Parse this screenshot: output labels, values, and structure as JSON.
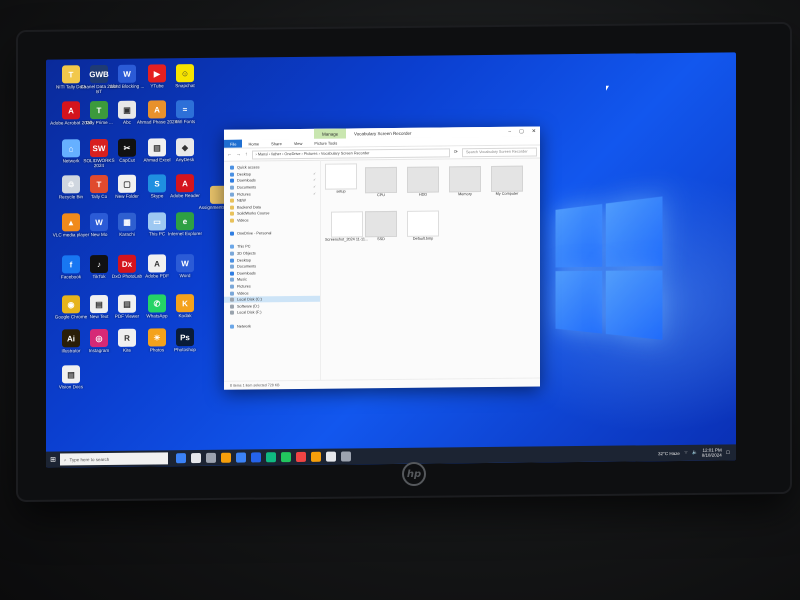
{
  "desktop": {
    "icons": [
      {
        "label": "NITI Tally Data",
        "color": "#f2c84b",
        "glyph": "T"
      },
      {
        "label": "Chanel Data 2024 BT",
        "color": "#1f3b73",
        "glyph": "GWB"
      },
      {
        "label": "Word Blocking ...",
        "color": "#2b5bd6",
        "glyph": "W"
      },
      {
        "label": "YTube",
        "color": "#e52020",
        "glyph": "▶"
      },
      {
        "label": "Snapchat",
        "color": "#f7e400",
        "glyph": "☺"
      },
      {
        "label": "Adobe Acrobat 2020",
        "color": "#d4141d",
        "glyph": "A"
      },
      {
        "label": "Tally Prime ...",
        "color": "#3c9a3c",
        "glyph": "T"
      },
      {
        "label": "Abc",
        "color": "#e8e8e8",
        "glyph": "▣"
      },
      {
        "label": "Ahmad Phase 2024",
        "color": "#e8912b",
        "glyph": "A"
      },
      {
        "label": "Wifi Fonts",
        "color": "#2d70d8",
        "glyph": "≈"
      },
      {
        "label": "Network",
        "color": "#66b0ff",
        "glyph": "⌂"
      },
      {
        "label": "SOLIDWORKS 2024",
        "color": "#d82020",
        "glyph": "SW"
      },
      {
        "label": "CapCut",
        "color": "#111111",
        "glyph": "✂"
      },
      {
        "label": "Ahmad Excel",
        "color": "#f0f0f0",
        "glyph": "▤"
      },
      {
        "label": "AnyDesk",
        "color": "#e8e8e8",
        "glyph": "◆"
      },
      {
        "label": "Recycle Bin",
        "color": "#cfd6df",
        "glyph": "♲"
      },
      {
        "label": "Tally Co",
        "color": "#e04a2e",
        "glyph": "T"
      },
      {
        "label": "New Folder",
        "color": "#f0f0f0",
        "glyph": "▢"
      },
      {
        "label": "Skype",
        "color": "#1f8fe0",
        "glyph": "S"
      },
      {
        "label": "Adobe Reader",
        "color": "#d4141d",
        "glyph": "A"
      },
      {
        "label": "VLC media player",
        "color": "#f08a1c",
        "glyph": "▲"
      },
      {
        "label": "New Mo",
        "color": "#2b5bd6",
        "glyph": "W"
      },
      {
        "label": "Karachi",
        "color": "#2e5fd0",
        "glyph": "▦"
      },
      {
        "label": "This PC",
        "color": "#9ec8f2",
        "glyph": "▭"
      },
      {
        "label": "Internet Explorer",
        "color": "#2ea043",
        "glyph": "e"
      },
      {
        "label": "Facebook",
        "color": "#1877f2",
        "glyph": "f"
      },
      {
        "label": "TikTok",
        "color": "#111111",
        "glyph": "♪"
      },
      {
        "label": "DxO PhotoLab",
        "color": "#d4141d",
        "glyph": "Dx"
      },
      {
        "label": "Adobe PDF",
        "color": "#f0f0f0",
        "glyph": "A"
      },
      {
        "label": "Word",
        "color": "#2b5bd6",
        "glyph": "W"
      },
      {
        "label": "Google Chrome",
        "color": "#e6b41c",
        "glyph": "◉"
      },
      {
        "label": "New Text",
        "color": "#f0f0f0",
        "glyph": "▤"
      },
      {
        "label": "PDF Viewer",
        "color": "#f0f0f0",
        "glyph": "▤"
      },
      {
        "label": "WhatsApp",
        "color": "#25d366",
        "glyph": "✆"
      },
      {
        "label": "Kodak",
        "color": "#f4a21c",
        "glyph": "K"
      },
      {
        "label": "Illustrator",
        "color": "#2a1e08",
        "glyph": "Ai"
      },
      {
        "label": "Instagram",
        "color": "#d62976",
        "glyph": "◎"
      },
      {
        "label": "Kite",
        "color": "#f0f0f0",
        "glyph": "R"
      },
      {
        "label": "Photos",
        "color": "#f4a21c",
        "glyph": "☀"
      },
      {
        "label": "Photoshop",
        "color": "#0a1c38",
        "glyph": "Ps"
      },
      {
        "label": "Vision Docs",
        "color": "#f0f0f0",
        "glyph": "▤"
      }
    ],
    "extra_folder": {
      "label": "Assignments Folder",
      "color": "#e7c26a"
    }
  },
  "explorer": {
    "manage_tab": "Manage",
    "title": "Vocabulary Screen Recorder",
    "controls": [
      "–",
      "▢",
      "✕"
    ],
    "tabs": [
      "File",
      "Home",
      "Share",
      "View",
      "Picture Tools"
    ],
    "path": "›  Mansi  ›  father  ›  OneDrive  ›  Pictures  ›  Vocabulary Screen Recorder",
    "search_placeholder": "Search Vocabulary Screen Recorder",
    "nav_items": [
      {
        "label": "Quick access",
        "color": "#4a90e2",
        "pin": ""
      },
      {
        "label": "Desktop",
        "color": "#4a90e2",
        "pin": "✓"
      },
      {
        "label": "Downloads",
        "color": "#2f7de1",
        "pin": "✓"
      },
      {
        "label": "Documents",
        "color": "#7aa7d8",
        "pin": "✓"
      },
      {
        "label": "Pictures",
        "color": "#7aa7d8",
        "pin": "✓"
      },
      {
        "label": "NEW",
        "color": "#e8c15a",
        "pin": ""
      },
      {
        "label": "Backend Data",
        "color": "#e8c15a",
        "pin": ""
      },
      {
        "label": "SolidWorks Course",
        "color": "#e8c15a",
        "pin": ""
      },
      {
        "label": "Videos",
        "color": "#e8c15a",
        "pin": ""
      },
      {
        "label": "",
        "color": "#ffffff",
        "pin": ""
      },
      {
        "label": "OneDrive - Personal",
        "color": "#2f7de1",
        "pin": ""
      },
      {
        "label": "",
        "color": "#ffffff",
        "pin": ""
      },
      {
        "label": "This PC",
        "color": "#6aa6e8",
        "pin": ""
      },
      {
        "label": "3D Objects",
        "color": "#7aa7d8",
        "pin": ""
      },
      {
        "label": "Desktop",
        "color": "#4a90e2",
        "pin": ""
      },
      {
        "label": "Documents",
        "color": "#7aa7d8",
        "pin": ""
      },
      {
        "label": "Downloads",
        "color": "#2f7de1",
        "pin": ""
      },
      {
        "label": "Music",
        "color": "#7aa7d8",
        "pin": ""
      },
      {
        "label": "Pictures",
        "color": "#7aa7d8",
        "pin": ""
      },
      {
        "label": "Videos",
        "color": "#7aa7d8",
        "pin": ""
      },
      {
        "label": "Local Disk (C:)",
        "color": "#9aa3ad",
        "pin": ""
      },
      {
        "label": "Software (D:)",
        "color": "#9aa3ad",
        "pin": ""
      },
      {
        "label": "Local Disk (F:)",
        "color": "#9aa3ad",
        "pin": ""
      },
      {
        "label": "",
        "color": "#ffffff",
        "pin": ""
      },
      {
        "label": "Network",
        "color": "#6aa6e8",
        "pin": ""
      }
    ],
    "selected_nav_index": 20,
    "files": [
      {
        "label": "setup",
        "style": "dark"
      },
      {
        "label": "CPU",
        "style": "plain"
      },
      {
        "label": "HDD",
        "style": "plain"
      },
      {
        "label": "Memory",
        "style": "plain"
      },
      {
        "label": "My Computer",
        "style": "plain"
      },
      {
        "label": "Screenshot_2024 11-11...",
        "style": "dark"
      },
      {
        "label": "SSD",
        "style": "plain"
      },
      {
        "label": "Default.bmp",
        "style": "dark"
      }
    ],
    "status": "8 items    1 item selected  728 KB"
  },
  "taskbar": {
    "start_glyph": "⊞",
    "search_placeholder": "Type here to search",
    "apps": [
      "#3b82f6",
      "#e5e7eb",
      "#9ca3af",
      "#f59e0b",
      "#3b82f6",
      "#2563eb",
      "#10b981",
      "#22c55e",
      "#ef4444",
      "#f59e0b",
      "#e5e7eb",
      "#9ca3af"
    ],
    "weather": "32°C Haze",
    "time": "12:01 PM",
    "date": "8/18/2024"
  },
  "monitor": {
    "brand": "hp"
  }
}
